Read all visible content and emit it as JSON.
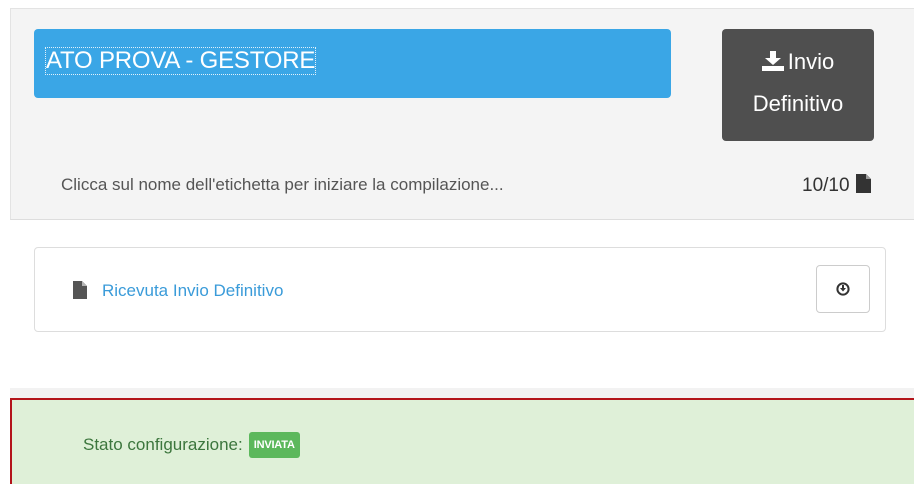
{
  "header": {
    "title": "ATO PROVA - GESTORE",
    "send_button_line1": "Invio",
    "send_button_line2": "Definitivo",
    "hint": "Clicca sul nome dell'etichetta per iniziare la compilazione...",
    "count": "10/10"
  },
  "documents": [
    {
      "label": "Ricevuta Invio Definitivo"
    }
  ],
  "status": {
    "label": "Stato configurazione:",
    "badge": "INVIATA"
  },
  "icons": {
    "send": "download-icon",
    "count": "file-icon",
    "document": "file-icon",
    "document_action": "circle-arrow-down-icon"
  },
  "colors": {
    "title_bg": "#3aa6e6",
    "send_bg": "#4f4f4f",
    "link": "#3a9bd9",
    "status_bg": "#dff0d8",
    "status_text": "#3c763d",
    "badge": "#5cb85c",
    "highlight_border": "#b3141b"
  }
}
